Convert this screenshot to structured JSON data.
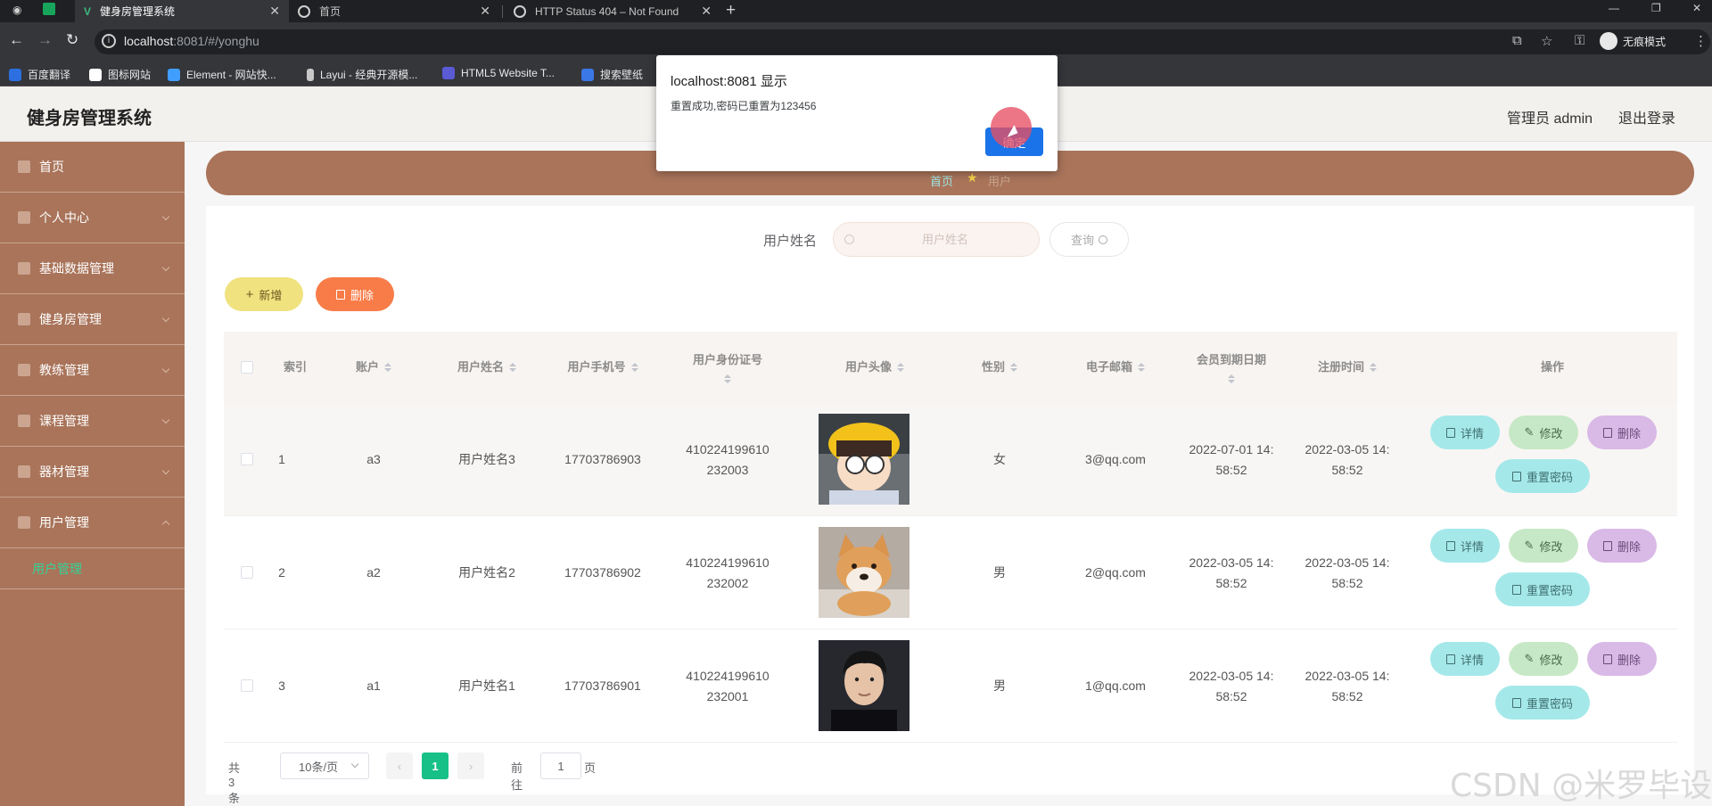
{
  "browser": {
    "tabs": [
      {
        "title": "健身房管理系统",
        "active": true
      },
      {
        "title": "首页",
        "active": false
      },
      {
        "title": "HTTP Status 404 – Not Found",
        "active": false
      }
    ],
    "url_host": "localhost",
    "url_rest": ":8081/#/yonghu",
    "incognito_label": "无痕模式",
    "bookmarks": [
      "百度翻译",
      "图标网站",
      "Element - 网站快...",
      "Layui - 经典开源模...",
      "HTML5 Website T...",
      "搜索壁纸"
    ]
  },
  "app": {
    "title": "健身房管理系统",
    "user_label": "管理员 admin",
    "logout_label": "退出登录"
  },
  "sidebar": {
    "items": [
      {
        "label": "首页",
        "icon": "home-icon"
      },
      {
        "label": "个人中心",
        "icon": "user-icon"
      },
      {
        "label": "基础数据管理",
        "icon": "data-icon"
      },
      {
        "label": "健身房管理",
        "icon": "gym-icon"
      },
      {
        "label": "教练管理",
        "icon": "coach-icon"
      },
      {
        "label": "课程管理",
        "icon": "course-icon"
      },
      {
        "label": "器材管理",
        "icon": "equipment-icon"
      },
      {
        "label": "用户管理",
        "icon": "users-icon"
      }
    ],
    "active_sub": "用户管理"
  },
  "breadcrumb": {
    "home": "首页",
    "current": "用户"
  },
  "search": {
    "label": "用户姓名",
    "placeholder": "用户姓名",
    "button": "查询"
  },
  "actions": {
    "add": "新增",
    "delete": "删除"
  },
  "table": {
    "headers": {
      "index": "索引",
      "account": "账户",
      "name": "用户姓名",
      "phone": "用户手机号",
      "idcard": "用户身份证号",
      "avatar": "用户头像",
      "gender": "性别",
      "email": "电子邮箱",
      "expire": "会员到期日期",
      "registered": "注册时间",
      "ops": "操作"
    },
    "rows": [
      {
        "index": "1",
        "account": "a3",
        "name": "用户姓名3",
        "phone": "17703786903",
        "idcard_1": "410224199610",
        "idcard_2": "232003",
        "gender": "女",
        "email": "3@qq.com",
        "expire_1": "2022-07-01 14:",
        "expire_2": "58:52",
        "reg_1": "2022-03-05 14:",
        "reg_2": "58:52"
      },
      {
        "index": "2",
        "account": "a2",
        "name": "用户姓名2",
        "phone": "17703786902",
        "idcard_1": "410224199610",
        "idcard_2": "232002",
        "gender": "男",
        "email": "2@qq.com",
        "expire_1": "2022-03-05 14:",
        "expire_2": "58:52",
        "reg_1": "2022-03-05 14:",
        "reg_2": "58:52"
      },
      {
        "index": "3",
        "account": "a1",
        "name": "用户姓名1",
        "phone": "17703786901",
        "idcard_1": "410224199610",
        "idcard_2": "232001",
        "gender": "男",
        "email": "1@qq.com",
        "expire_1": "2022-03-05 14:",
        "expire_2": "58:52",
        "reg_1": "2022-03-05 14:",
        "reg_2": "58:52"
      }
    ],
    "op_labels": {
      "detail": "详情",
      "edit": "修改",
      "delete": "删除",
      "reset": "重置密码"
    }
  },
  "pagination": {
    "total": "共 3 条",
    "page_size": "10条/页",
    "current": "1",
    "goto_label": "前往",
    "goto_value": "1",
    "page_suffix": "页"
  },
  "dialog": {
    "title": "localhost:8081 显示",
    "message": "重置成功,密码已重置为123456",
    "ok": "确定"
  },
  "watermark": "CSDN @米罗毕设",
  "colors": {
    "sidebar": "#a9745a",
    "active_sub": "#35d296",
    "pager_active": "#17c086",
    "add_button": "#f0e27e",
    "delete_button": "#f87c48"
  }
}
